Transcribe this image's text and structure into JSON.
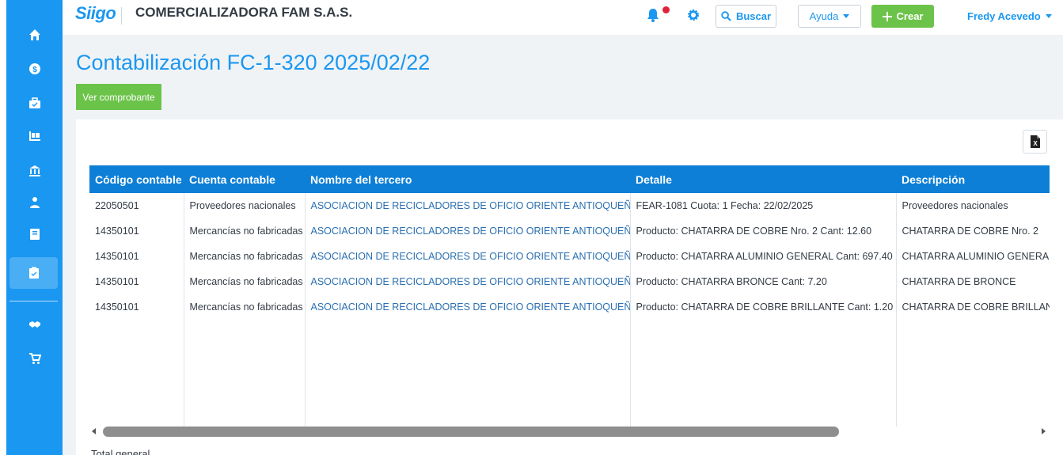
{
  "header": {
    "logo": "Siigo",
    "company": "COMERCIALIZADORA FAM S.A.S.",
    "search_label": "Buscar",
    "help_label": "Ayuda",
    "create_label": "Crear",
    "user_name": "Fredy Acevedo"
  },
  "sidebar": {
    "items": [
      {
        "icon": "home-icon"
      },
      {
        "icon": "dollar-coin-icon"
      },
      {
        "icon": "briefcase-check-icon"
      },
      {
        "icon": "inventory-cart-icon"
      },
      {
        "icon": "bank-icon"
      },
      {
        "icon": "user-tie-icon"
      },
      {
        "icon": "book-icon"
      },
      {
        "icon": "clipboard-check-icon",
        "active": true
      },
      {
        "icon": "handshake-icon"
      },
      {
        "icon": "shopping-cart-icon"
      }
    ]
  },
  "page": {
    "title": "Contabilización FC-1-320 2025/02/22",
    "view_button": "Ver comprobante",
    "total_label": "Total general"
  },
  "table": {
    "headers": [
      "Código contable",
      "Cuenta contable",
      "Nombre del tercero",
      "Detalle",
      "Descripción"
    ],
    "rows": [
      [
        "22050501",
        "Proveedores nacionales",
        "ASOCIACION DE RECICLADORES DE OFICIO ORIENTE ANTIOQUEÑO",
        "FEAR-1081 Cuota: 1 Fecha: 22/02/2025",
        "Proveedores nacionales"
      ],
      [
        "14350101",
        "Mercancías no fabricadas",
        "ASOCIACION DE RECICLADORES DE OFICIO ORIENTE ANTIOQUEÑO",
        "Producto: CHATARRA DE COBRE Nro. 2 Cant: 12.60",
        "CHATARRA DE COBRE Nro. 2"
      ],
      [
        "14350101",
        "Mercancías no fabricadas",
        "ASOCIACION DE RECICLADORES DE OFICIO ORIENTE ANTIOQUEÑO",
        "Producto: CHATARRA ALUMINIO GENERAL Cant: 697.40",
        "CHATARRA ALUMINIO GENERAL"
      ],
      [
        "14350101",
        "Mercancías no fabricadas",
        "ASOCIACION DE RECICLADORES DE OFICIO ORIENTE ANTIOQUEÑO",
        "Producto: CHATARRA BRONCE Cant: 7.20",
        "CHATARRA DE BRONCE"
      ],
      [
        "14350101",
        "Mercancías no fabricadas",
        "ASOCIACION DE RECICLADORES DE OFICIO ORIENTE ANTIOQUEÑO",
        "Producto: CHATARRA DE COBRE BRILLANTE Cant: 1.20",
        "CHATARRA DE COBRE BRILLANTE"
      ]
    ]
  },
  "colors": {
    "primary": "#1a97f0",
    "table_header": "#0e7fd6",
    "success": "#6cc34a",
    "notification": "#e0213a"
  }
}
